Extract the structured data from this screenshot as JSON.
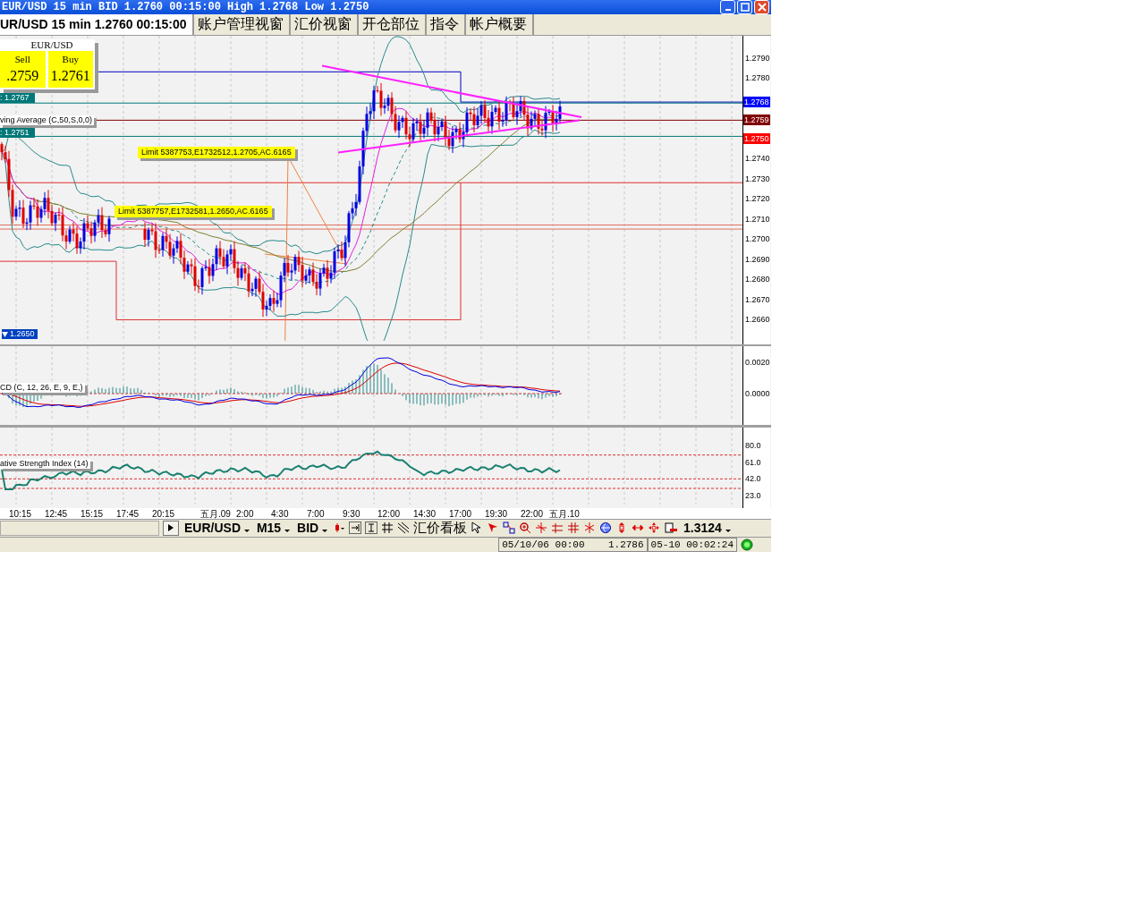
{
  "window": {
    "title": "EUR/USD 15 min BID 1.2760 00:15:00 High 1.2768 Low 1.2750"
  },
  "tabs": [
    {
      "label": "UR/USD 15 min 1.2760 00:15:00",
      "selected": true
    },
    {
      "label": "账户管理视窗",
      "selected": false
    },
    {
      "label": "汇价视窗",
      "selected": false
    },
    {
      "label": "开仓部位",
      "selected": false
    },
    {
      "label": "指令",
      "selected": false
    },
    {
      "label": "帐户概要",
      "selected": false
    }
  ],
  "quote_panel": {
    "symbol": "EUR/USD",
    "sell_label": "Sell",
    "buy_label": "Buy",
    "sell_price": ".2759",
    "buy_price": "1.2761"
  },
  "line_tags": [
    {
      "text": ": 1.2767"
    },
    {
      "text": ": 1.2751"
    }
  ],
  "indicator_label": "ving Average (C,50,S,0,0)",
  "order_labels": [
    {
      "text": "Limit 5387753,E1732512,1.2705,AC.6165"
    },
    {
      "text": "Limit 5387757,E1732581,1.2650,AC.6165"
    }
  ],
  "stop_marker": "1.2650",
  "price_axis": {
    "ticks": [
      "1.2790",
      "1.2780",
      "1.2740",
      "1.2730",
      "1.2720",
      "1.2710",
      "1.2700",
      "1.2690",
      "1.2680",
      "1.2670",
      "1.2660"
    ],
    "flags": [
      {
        "text": "1.2768",
        "color": "#0000ff"
      },
      {
        "text": "1.2759",
        "color": "#800000"
      },
      {
        "text": "1.2750",
        "color": "#ff0000"
      }
    ]
  },
  "macd": {
    "label": "CD (C, 12, 26, E, 9, E,)",
    "ticks": [
      "0.0020",
      "0.0000"
    ]
  },
  "rsi": {
    "label": "ative Strength Index (14)",
    "ticks": [
      "80.0",
      "61.0",
      "42.0",
      "23.0"
    ]
  },
  "time_axis": [
    "10:15",
    "12:45",
    "15:15",
    "17:45",
    "20:15",
    "五月.09",
    "2:00",
    "4:30",
    "7:00",
    "9:30",
    "12:00",
    "14:30",
    "17:00",
    "19:30",
    "22:00",
    "五月.10"
  ],
  "toolbar": {
    "symbol": "EUR/USD",
    "timeframe": "M15",
    "price_type": "BID",
    "board": "汇价看板",
    "value": "1.3124"
  },
  "status_bar": {
    "datetime": "05/10/06 00:00",
    "price": "1.2786",
    "clock": "05-10 00:02:24"
  }
}
